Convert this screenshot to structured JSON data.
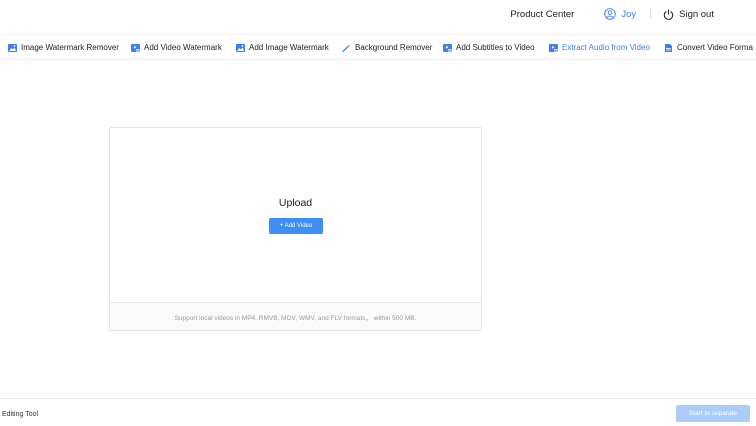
{
  "header": {
    "product_center": "Product Center",
    "username": "Joy",
    "sign_out": "Sign out"
  },
  "tabs": [
    {
      "label": "Image Watermark Remover",
      "icon": "image-icon",
      "active": false
    },
    {
      "label": "Add Video Watermark",
      "icon": "video-plus-icon",
      "active": false
    },
    {
      "label": "Add Image Watermark",
      "icon": "image-icon",
      "active": false
    },
    {
      "label": "Background Remover",
      "icon": "magic-wand-icon",
      "active": false
    },
    {
      "label": "Add Subtitles to Video",
      "icon": "video-plus-icon",
      "active": false
    },
    {
      "label": "Extract Audio from Video",
      "icon": "video-plus-icon",
      "active": true
    },
    {
      "label": "Convert Video Forma",
      "icon": "document-icon",
      "active": false
    }
  ],
  "upload": {
    "title": "Upload",
    "button": "+ Add Video",
    "hint": "Support local videos in MP4, RMVB, MOV, WMV, and FLV formats， within 500 MB."
  },
  "footer": {
    "editing_tool": "Editing Tool",
    "start_button": "Start to separate"
  },
  "colors": {
    "accent": "#3d7ff0",
    "button": "#3f8ef3",
    "button_disabled": "#a9cdfb"
  }
}
